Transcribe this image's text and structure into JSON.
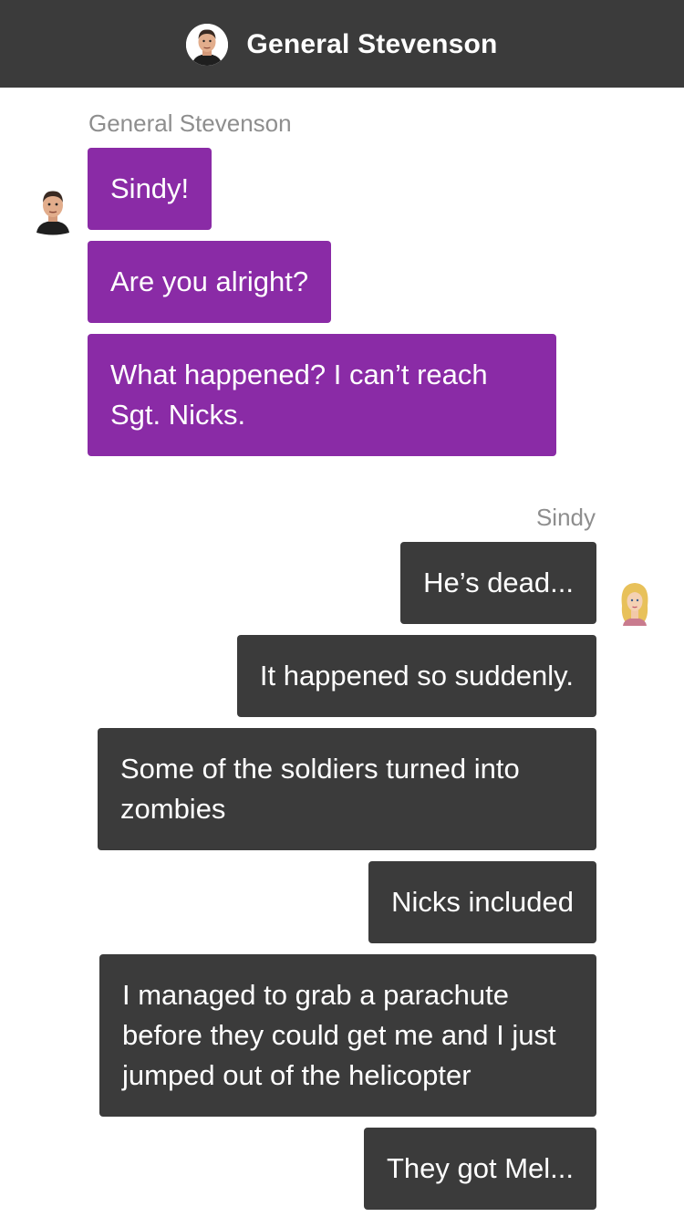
{
  "header": {
    "title": "General Stevenson",
    "avatar_icon": "general-stevenson-avatar"
  },
  "conversation": {
    "general_name": "General Stevenson",
    "sindy_name": "Sindy",
    "incoming": [
      {
        "text": "Sindy!"
      },
      {
        "text": "Are you alright?"
      },
      {
        "text": "What happened? I can’t reach Sgt. Nicks."
      }
    ],
    "outgoing": [
      {
        "text": "He’s dead..."
      },
      {
        "text": "It happened so suddenly."
      },
      {
        "text": "Some of the soldiers turned into zombies"
      },
      {
        "text": "Nicks included"
      },
      {
        "text": "I managed to grab a parachute before they could get me and I just jumped out of the helicopter"
      },
      {
        "text": "They got Mel..."
      }
    ]
  },
  "colors": {
    "header_bg": "#3b3b3b",
    "incoming_bubble": "#8a2ba6",
    "outgoing_bubble": "#3b3b3b",
    "sender_label": "#8e8e8e"
  }
}
